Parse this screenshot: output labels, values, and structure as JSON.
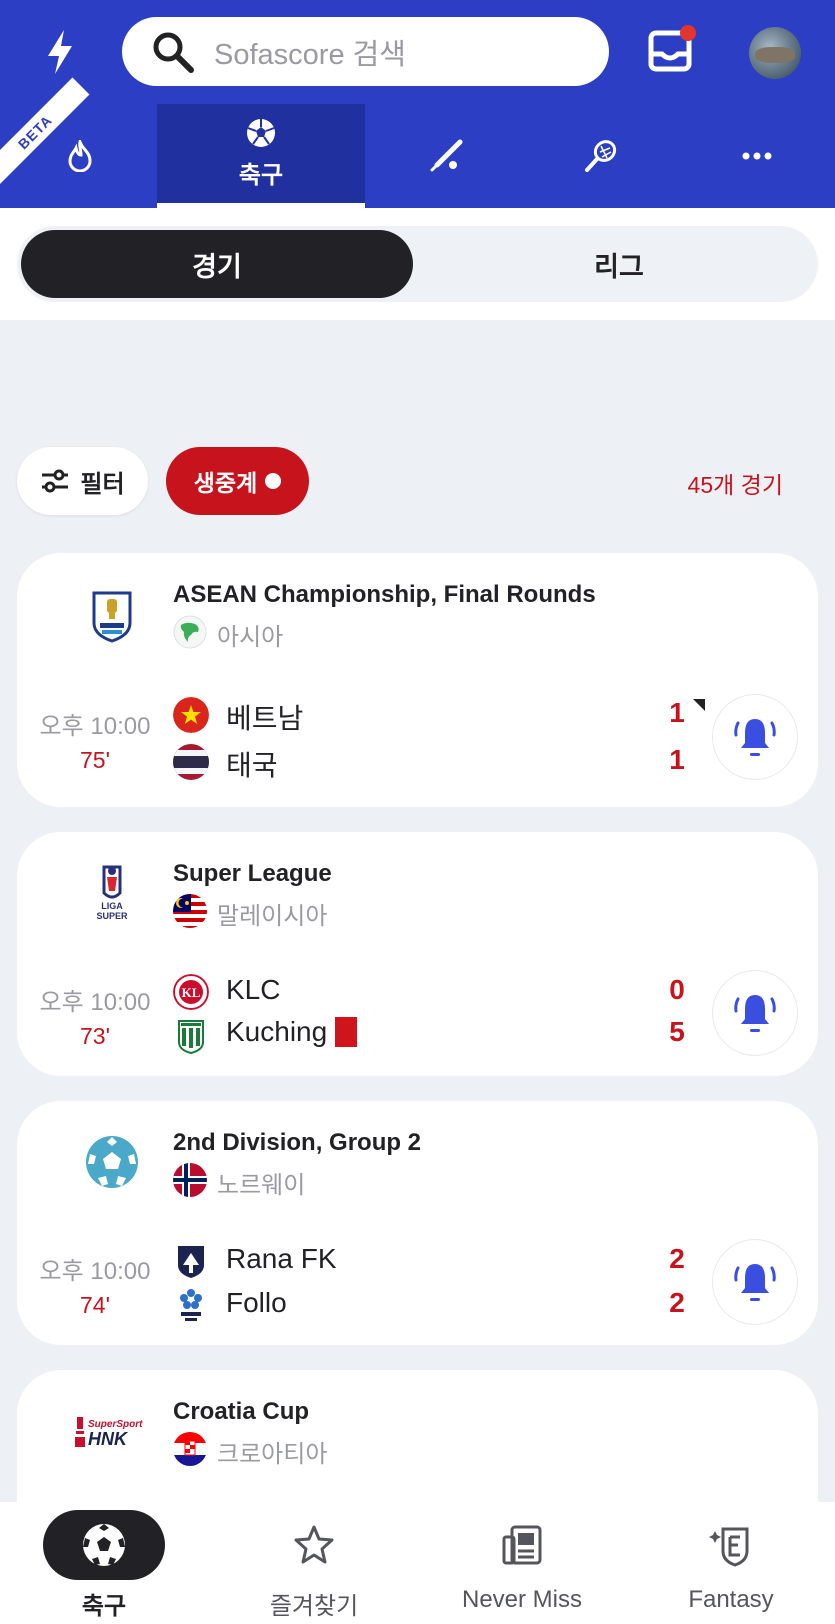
{
  "search": {
    "placeholder": "Sofascore 검색"
  },
  "header": {
    "beta": "BETA"
  },
  "sport_tabs": [
    {
      "icon": "flame-icon",
      "label": ""
    },
    {
      "icon": "soccer-ball-icon",
      "label": "축구",
      "active": true
    },
    {
      "icon": "baseball-bat-icon",
      "label": ""
    },
    {
      "icon": "tennis-racket-icon",
      "label": ""
    },
    {
      "icon": "more-icon",
      "label": ""
    }
  ],
  "segment": {
    "matches": "경기",
    "leagues": "리그"
  },
  "filters": {
    "filter_label": "필터",
    "live_label": "생중계",
    "count": "45개 경기"
  },
  "cards": [
    {
      "league": "ASEAN Championship, Final Rounds",
      "country": "아시아",
      "time": "오후 10:00",
      "minute": "75'",
      "home": {
        "name": "베트남",
        "score": "1"
      },
      "away": {
        "name": "태국",
        "score": "1"
      }
    },
    {
      "league": "Super League",
      "country": "말레이시아",
      "time": "오후 10:00",
      "minute": "73'",
      "home": {
        "name": "KLC",
        "score": "0"
      },
      "away": {
        "name": "Kuching",
        "score": "5"
      }
    },
    {
      "league": "2nd Division, Group 2",
      "country": "노르웨이",
      "time": "오후 10:00",
      "minute": "74'",
      "home": {
        "name": "Rana FK",
        "score": "2"
      },
      "away": {
        "name": "Follo",
        "score": "2"
      }
    },
    {
      "league": "Croatia Cup",
      "country": "크로아티아",
      "logo_text": "SuperSport HNK"
    }
  ],
  "bottom_nav": [
    {
      "label": "축구",
      "icon": "soccer-ball-icon",
      "active": true
    },
    {
      "label": "즐겨찾기",
      "icon": "star-icon"
    },
    {
      "label": "Never Miss",
      "icon": "news-icon"
    },
    {
      "label": "Fantasy",
      "icon": "fantasy-shield-icon"
    }
  ],
  "colors": {
    "brand": "#2c3ec4",
    "live": "#c7141c",
    "dark": "#222226",
    "bell": "#3a4ee0"
  }
}
